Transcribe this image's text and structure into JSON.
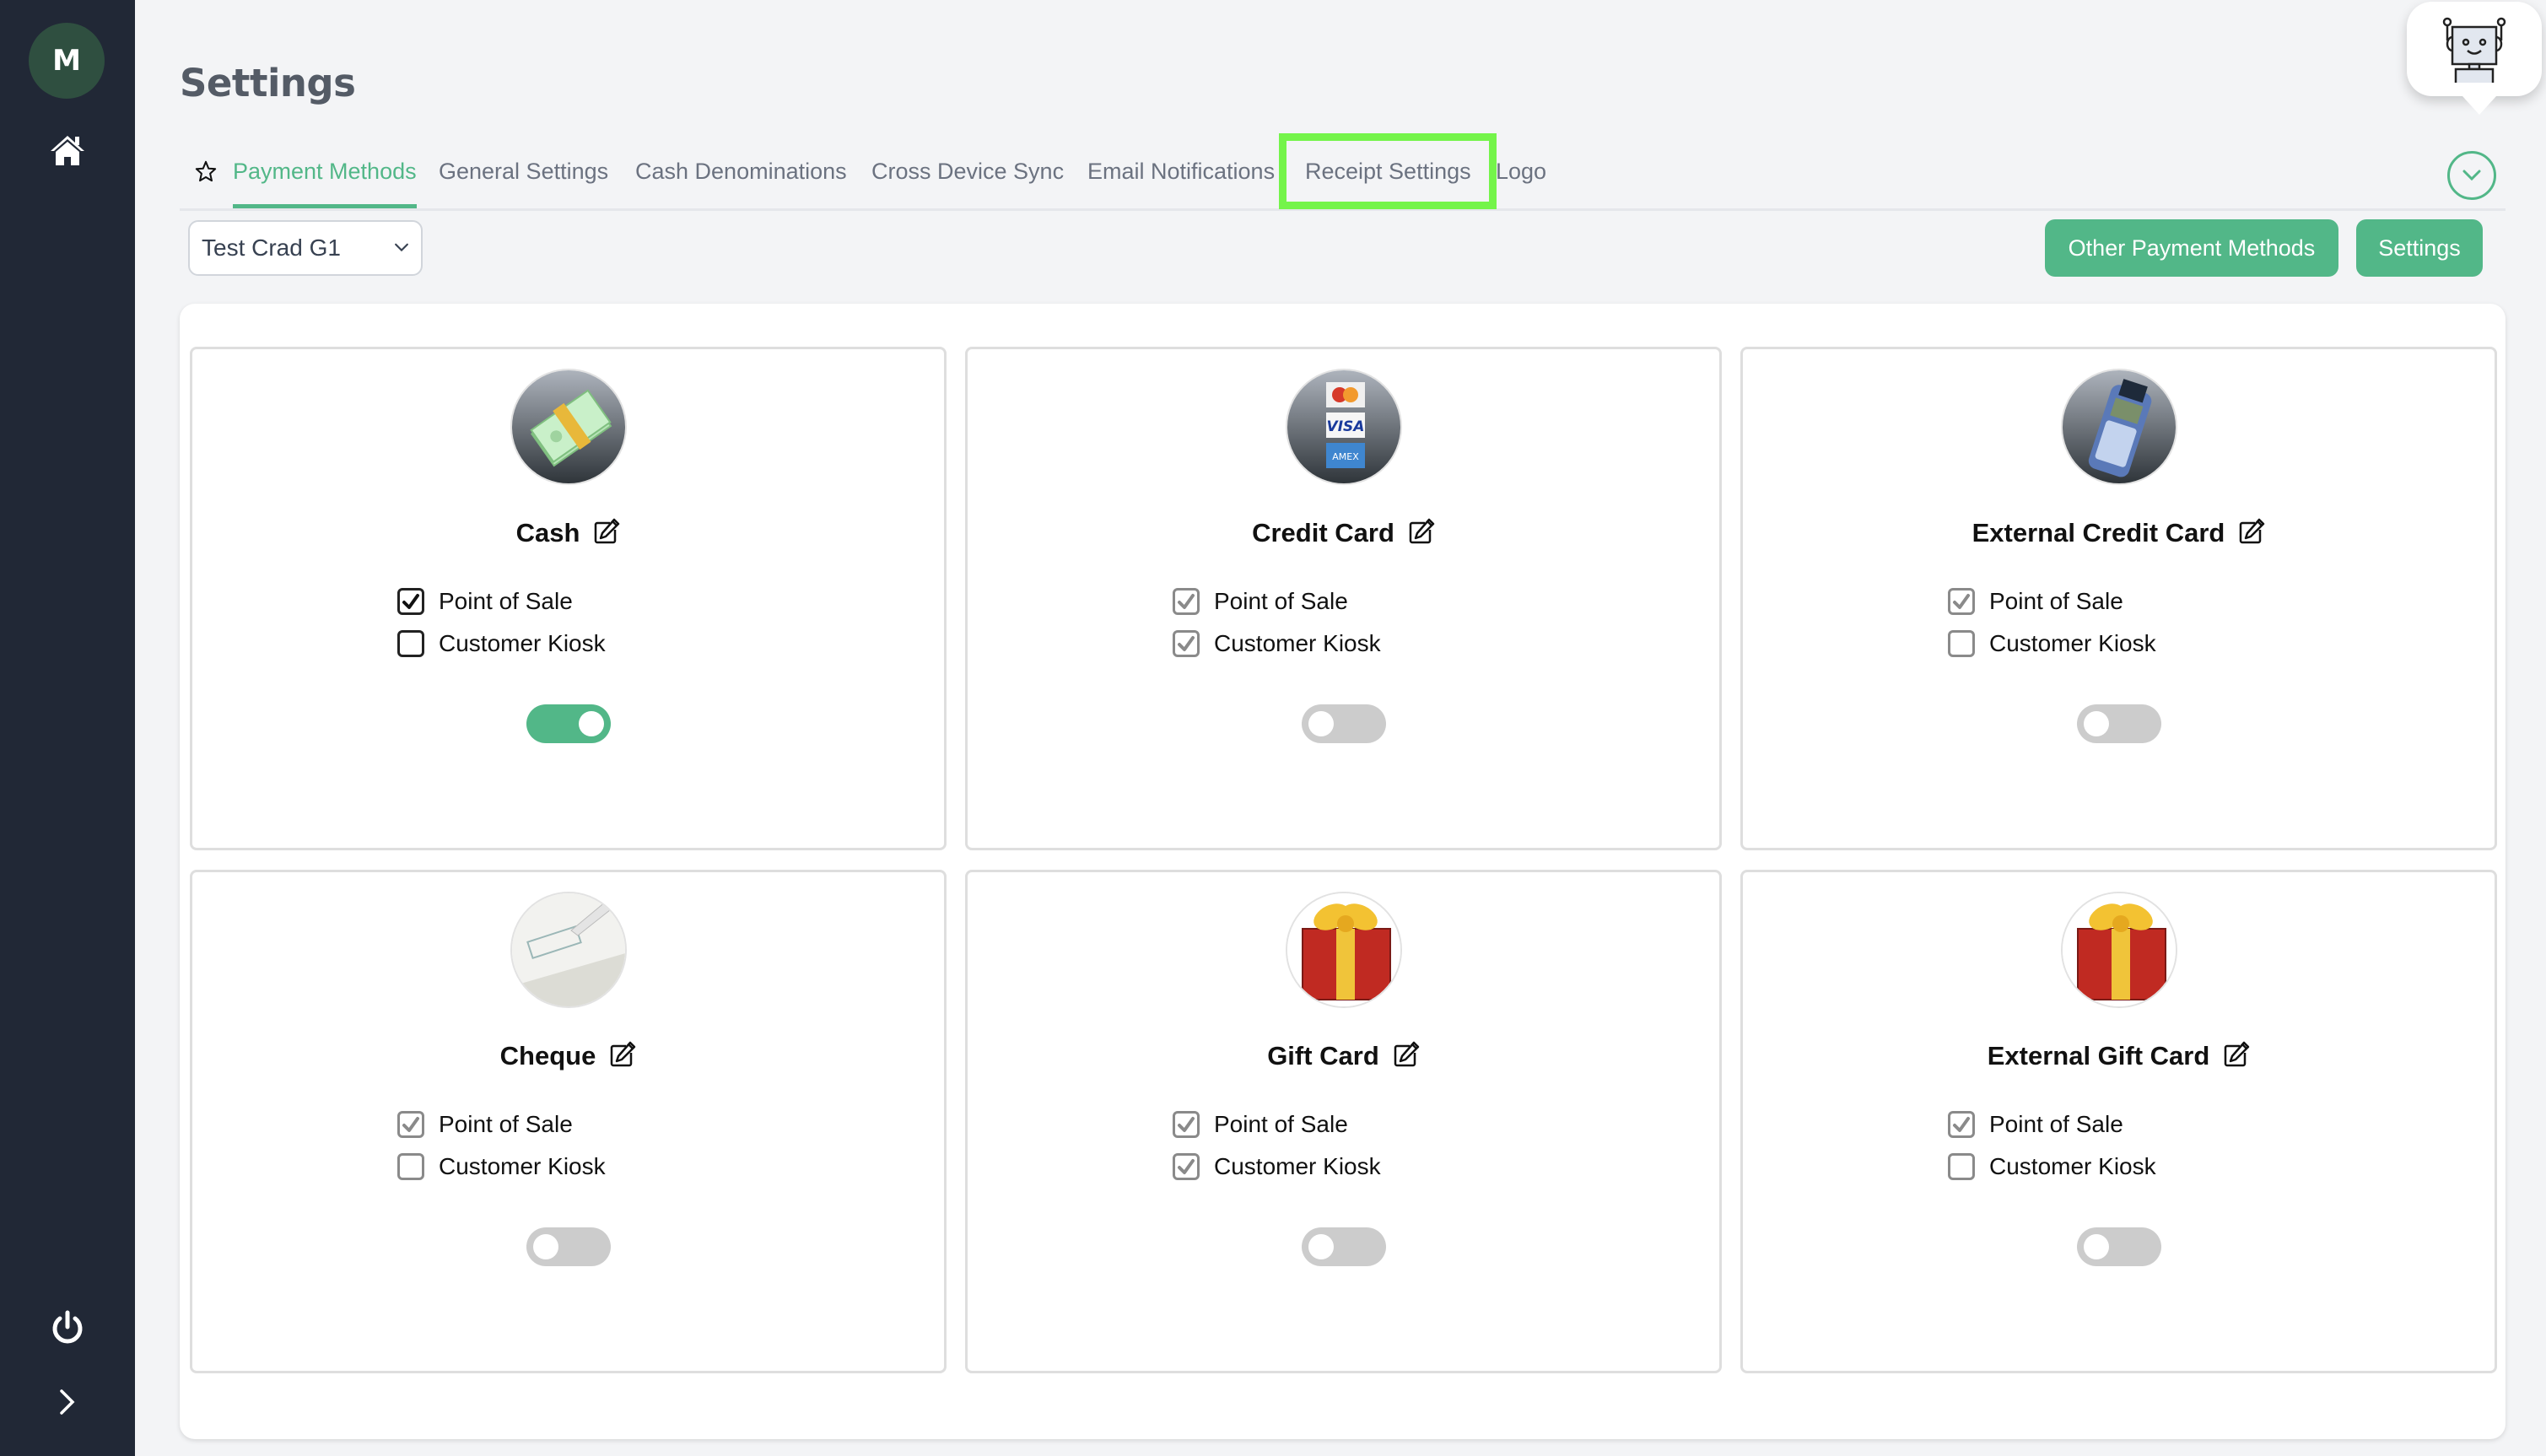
{
  "sidebar": {
    "avatar_initial": "M",
    "items": [
      {
        "icon": "home-icon"
      },
      {
        "icon": "power-icon"
      },
      {
        "icon": "chevron-right-icon"
      }
    ],
    "bg_color": "#212836",
    "avatar_color": "#2f4f40"
  },
  "header": {
    "title": "Settings"
  },
  "tabs": [
    {
      "label": "Payment Methods",
      "active": true,
      "starred": true
    },
    {
      "label": "General Settings",
      "active": false
    },
    {
      "label": "Cash Denominations",
      "active": false
    },
    {
      "label": "Cross Device Sync",
      "active": false
    },
    {
      "label": "Email Notifications",
      "active": false
    },
    {
      "label": "Receipt Settings",
      "active": false,
      "highlighted": true
    },
    {
      "label": "Logo",
      "active": false
    }
  ],
  "toolbar": {
    "location_select": {
      "value": "Test Crad G1"
    },
    "other_payment_methods_label": "Other Payment Methods",
    "settings_label": "Settings"
  },
  "colors": {
    "accent": "#52b788",
    "highlight": "#74f44a",
    "toggle_off": "#cccccc"
  },
  "payment_methods": [
    {
      "name": "Cash",
      "icon": "cash-icon",
      "point_of_sale": true,
      "point_of_sale_disabled": false,
      "customer_kiosk": false,
      "customer_kiosk_disabled": false,
      "enabled": true
    },
    {
      "name": "Credit Card",
      "icon": "credit-card-icon",
      "point_of_sale": true,
      "point_of_sale_disabled": true,
      "customer_kiosk": true,
      "customer_kiosk_disabled": true,
      "enabled": false
    },
    {
      "name": "External Credit Card",
      "icon": "card-terminal-icon",
      "point_of_sale": true,
      "point_of_sale_disabled": true,
      "customer_kiosk": false,
      "customer_kiosk_disabled": true,
      "enabled": false
    },
    {
      "name": "Cheque",
      "icon": "cheque-icon",
      "point_of_sale": true,
      "point_of_sale_disabled": true,
      "customer_kiosk": false,
      "customer_kiosk_disabled": true,
      "enabled": false
    },
    {
      "name": "Gift Card",
      "icon": "gift-icon",
      "point_of_sale": true,
      "point_of_sale_disabled": true,
      "customer_kiosk": true,
      "customer_kiosk_disabled": true,
      "enabled": false
    },
    {
      "name": "External Gift Card",
      "icon": "gift-icon",
      "point_of_sale": true,
      "point_of_sale_disabled": true,
      "customer_kiosk": false,
      "customer_kiosk_disabled": true,
      "enabled": false
    }
  ],
  "labels": {
    "point_of_sale": "Point of Sale",
    "customer_kiosk": "Customer Kiosk"
  }
}
